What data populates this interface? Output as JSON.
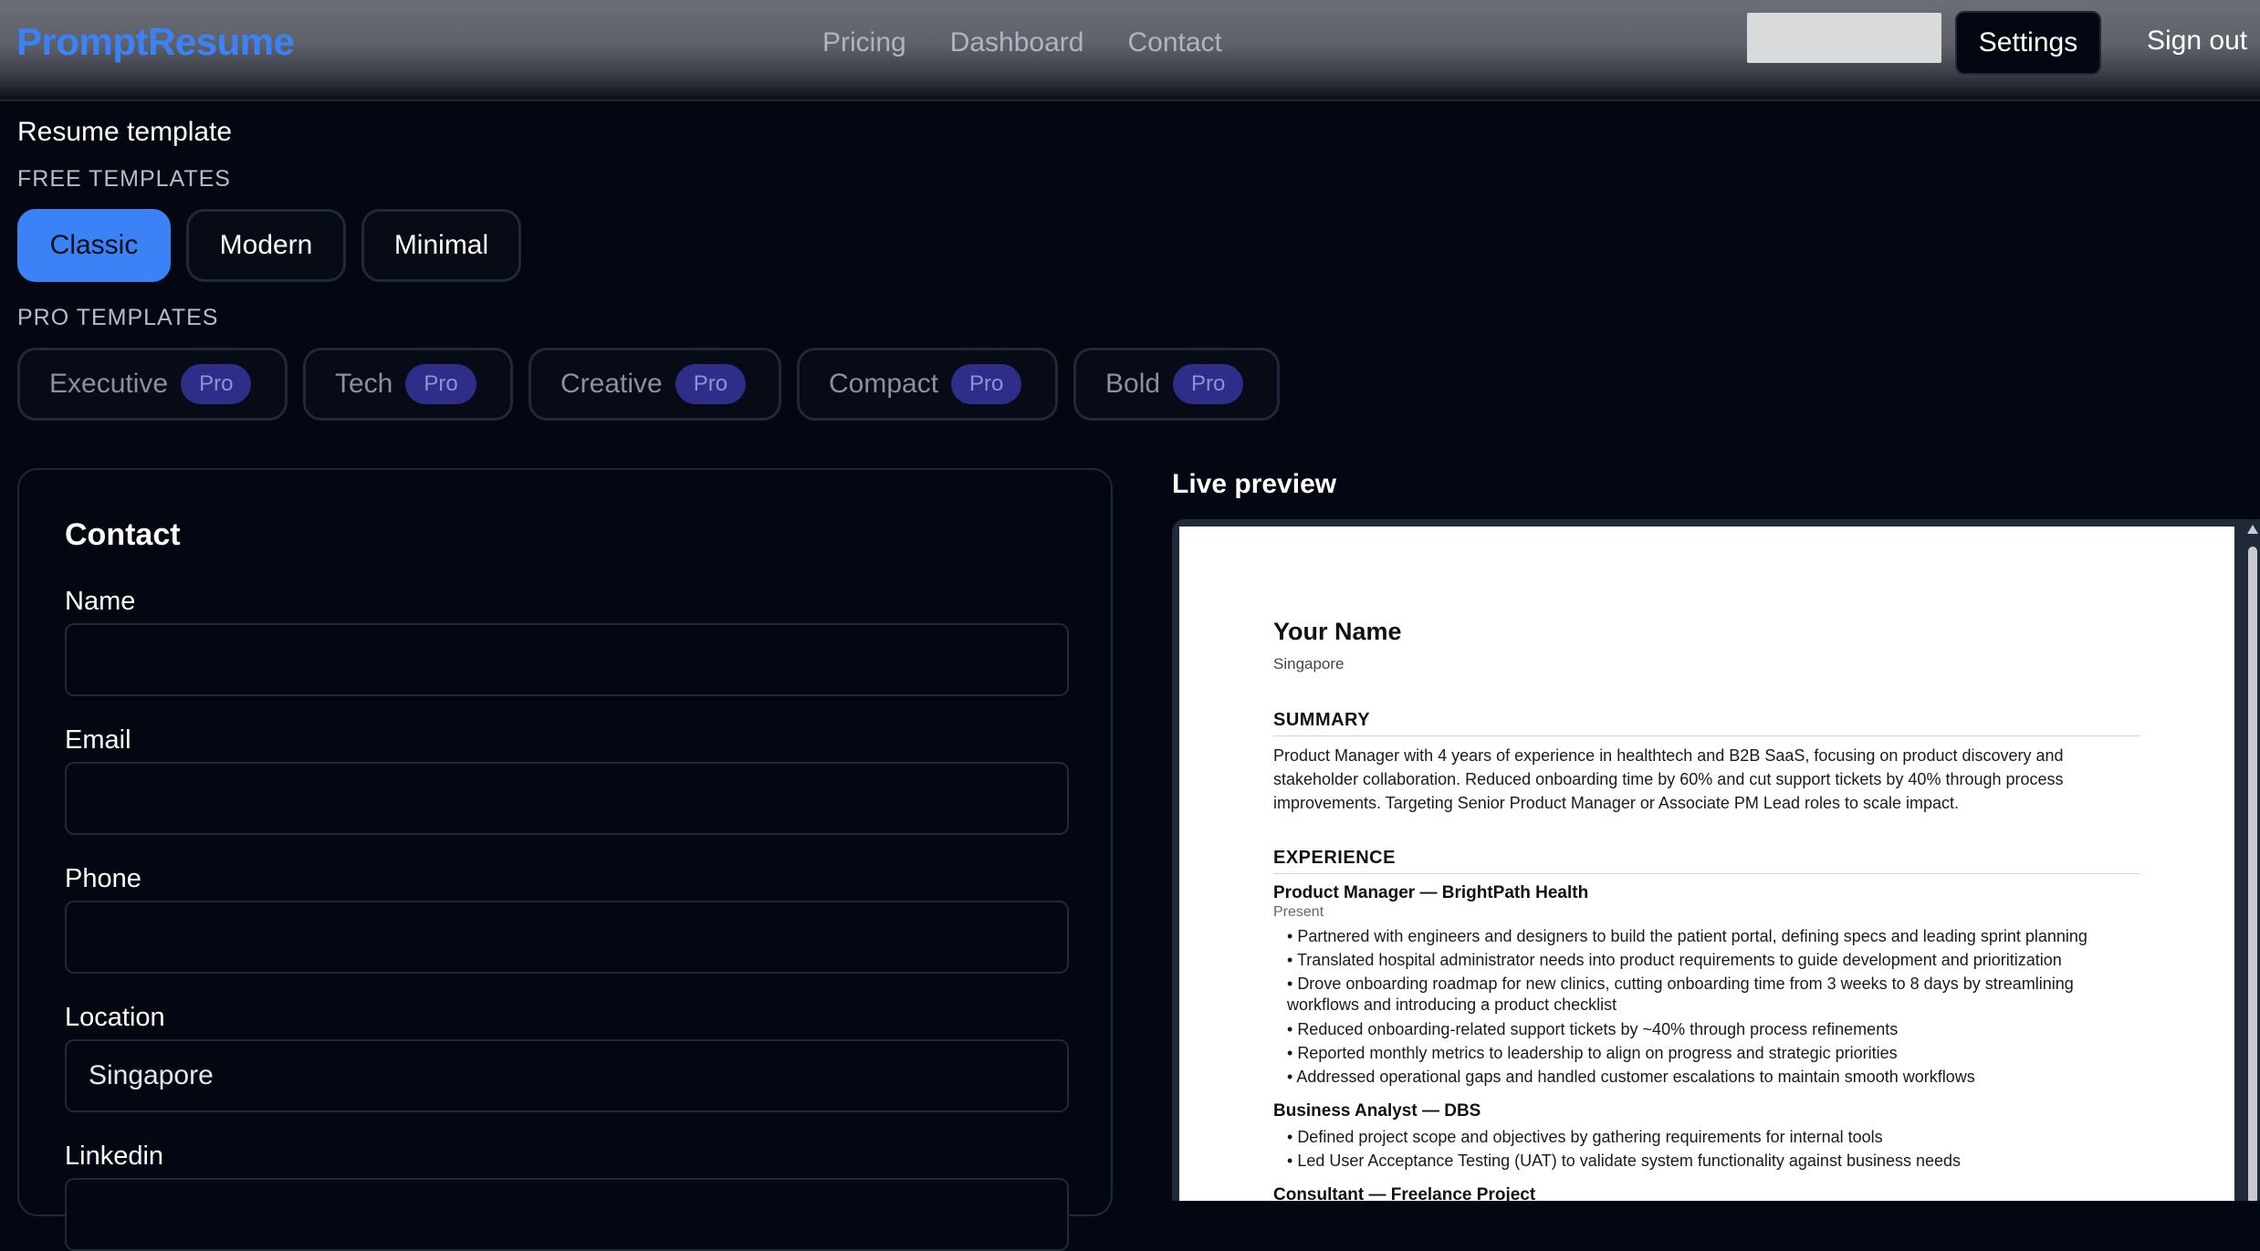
{
  "navbar": {
    "brand": "PromptResume",
    "links": [
      "Pricing",
      "Dashboard",
      "Contact"
    ],
    "settings_label": "Settings",
    "signout_label": "Sign out"
  },
  "templates": {
    "title": "Resume template",
    "free_label": "FREE TEMPLATES",
    "free": [
      "Classic",
      "Modern",
      "Minimal"
    ],
    "selected": "Classic",
    "pro_label": "PRO TEMPLATES",
    "pro": [
      "Executive",
      "Tech",
      "Creative",
      "Compact",
      "Bold"
    ],
    "pro_badge": "Pro"
  },
  "form": {
    "heading": "Contact",
    "fields": [
      {
        "label": "Name",
        "value": ""
      },
      {
        "label": "Email",
        "value": ""
      },
      {
        "label": "Phone",
        "value": ""
      },
      {
        "label": "Location",
        "value": "Singapore"
      },
      {
        "label": "Linkedin",
        "value": ""
      }
    ]
  },
  "preview": {
    "title": "Live preview",
    "resume": {
      "name": "Your Name",
      "location": "Singapore",
      "summary_heading": "SUMMARY",
      "summary": "Product Manager with 4 years of experience in healthtech and B2B SaaS, focusing on product discovery and stakeholder collaboration. Reduced onboarding time by 60% and cut support tickets by 40% through process improvements. Targeting Senior Product Manager or Associate PM Lead roles to scale impact.",
      "experience_heading": "EXPERIENCE",
      "jobs": [
        {
          "title": "Product Manager — BrightPath Health",
          "date": "Present",
          "bullets": [
            "Partnered with engineers and designers to build the patient portal, defining specs and leading sprint planning",
            "Translated hospital administrator needs into product requirements to guide development and prioritization",
            "Drove onboarding roadmap for new clinics, cutting onboarding time from 3 weeks to 8 days by streamlining workflows and introducing a product checklist",
            "Reduced onboarding-related support tickets by ~40% through process refinements",
            "Reported monthly metrics to leadership to align on progress and strategic priorities",
            "Addressed operational gaps and handled customer escalations to maintain smooth workflows"
          ]
        },
        {
          "title": "Business Analyst — DBS",
          "date": "",
          "bullets": [
            "Defined project scope and objectives by gathering requirements for internal tools",
            "Led User Acceptance Testing (UAT) to validate system functionality against business needs"
          ]
        },
        {
          "title": "Consultant — Freelance Project",
          "date": "",
          "bullets": []
        }
      ]
    }
  }
}
